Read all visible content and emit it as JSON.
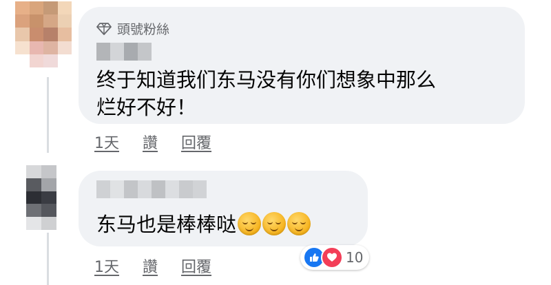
{
  "comments": [
    {
      "badge_label": "頭號粉絲",
      "text_line1": "终于知道我们东马没有你们想象中那么",
      "text_line2": "烂好不好！",
      "actions": {
        "time": "1天",
        "like": "讚",
        "reply": "回覆"
      }
    },
    {
      "text": "东马也是棒棒哒",
      "emojis": [
        "relieved-face",
        "relieved-face",
        "relieved-face"
      ],
      "actions": {
        "time": "1天",
        "like": "讚",
        "reply": "回覆"
      },
      "reactions": {
        "types": [
          "like",
          "love"
        ],
        "count": "10"
      }
    }
  ],
  "colors": {
    "bubble": "#f0f2f5",
    "meta_text": "#65676b",
    "like_blue": "#1877f2",
    "love_red": "#f33e58"
  }
}
